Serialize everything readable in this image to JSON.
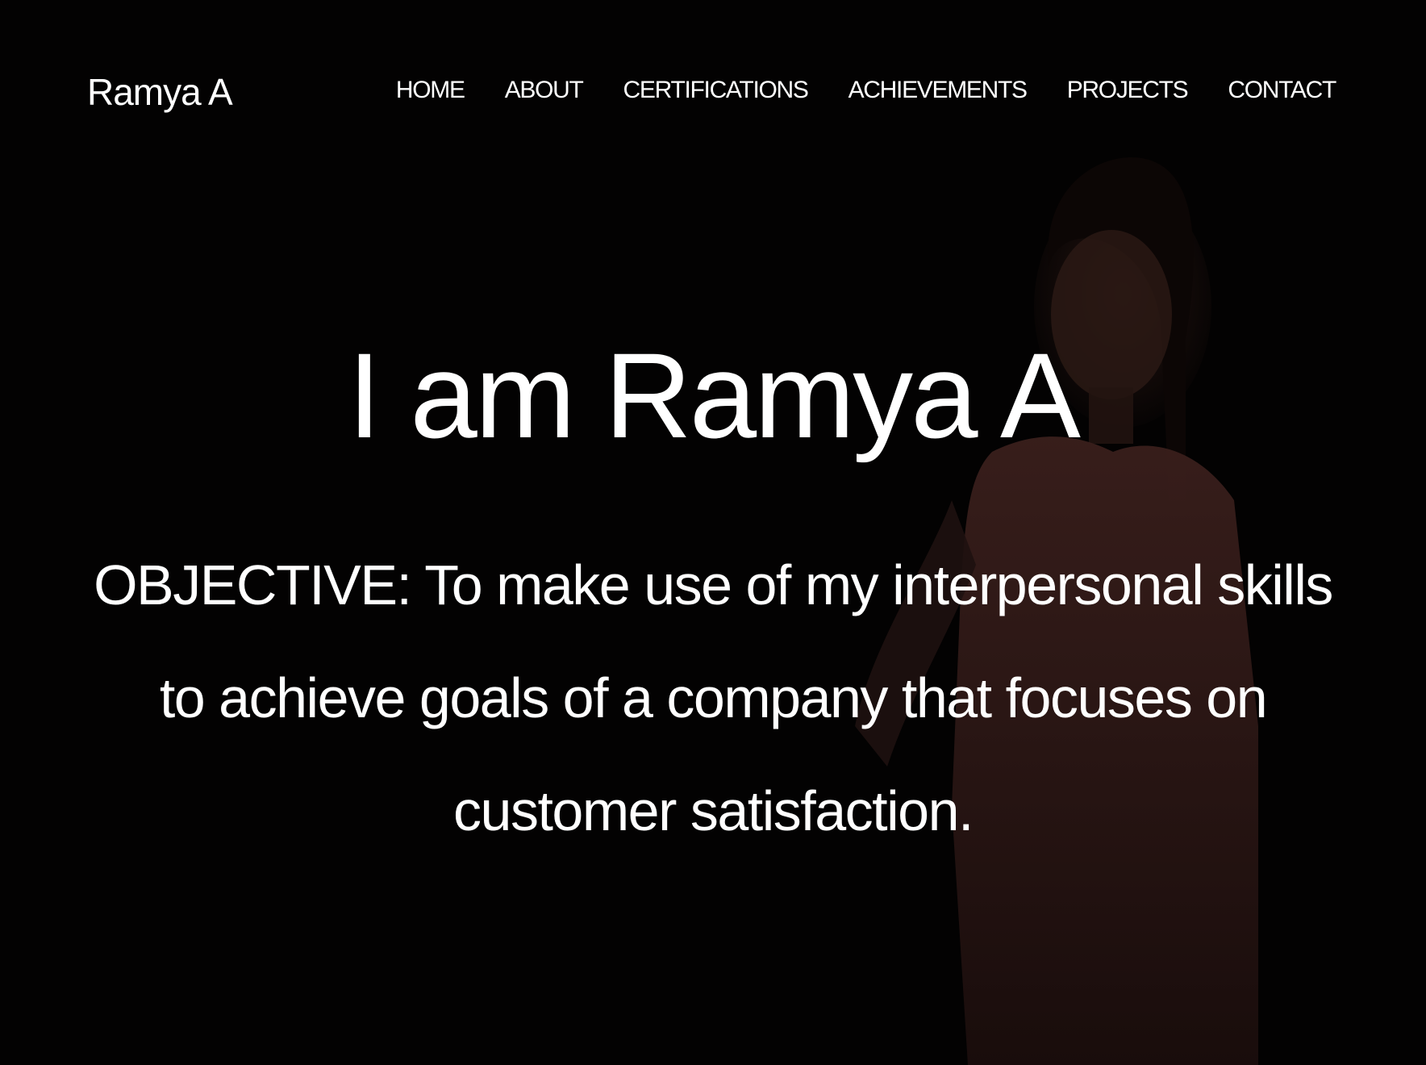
{
  "header": {
    "brand": "Ramya A",
    "nav": [
      {
        "label": "HOME"
      },
      {
        "label": "ABOUT"
      },
      {
        "label": "CERTIFICATIONS"
      },
      {
        "label": "ACHIEVEMENTS"
      },
      {
        "label": "PROJECTS"
      },
      {
        "label": "CONTACT"
      }
    ]
  },
  "hero": {
    "title": "I am Ramya A",
    "objective": "OBJECTIVE: To make use of my interpersonal skills to achieve goals of a company that focuses on customer satisfaction."
  },
  "colors": {
    "background": "#030202",
    "text": "#ffffff"
  }
}
